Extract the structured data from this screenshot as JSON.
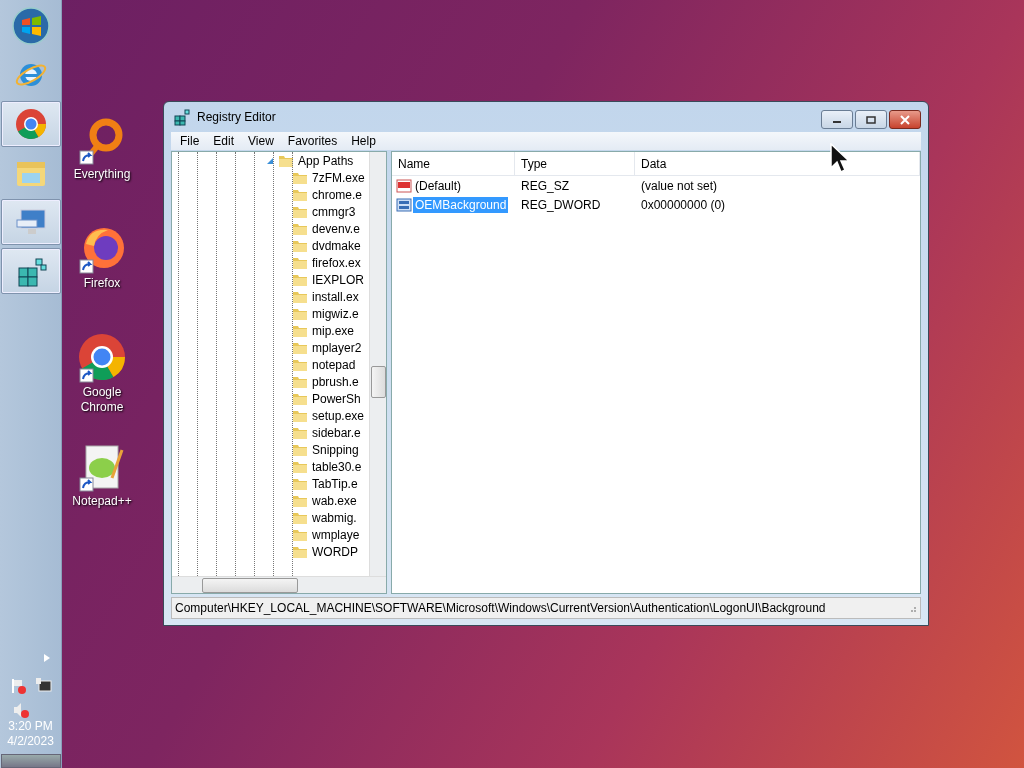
{
  "taskbar": {
    "items": [
      {
        "kind": "start",
        "running": false
      },
      {
        "kind": "ie",
        "running": false
      },
      {
        "kind": "chrome",
        "running": true
      },
      {
        "kind": "explorer",
        "running": false
      },
      {
        "kind": "remote",
        "running": true
      },
      {
        "kind": "regedit",
        "running": true
      }
    ],
    "tray": {
      "time": "3:20 PM",
      "date": "4/2/2023"
    }
  },
  "desktop_icons": [
    {
      "kind": "everything",
      "label": "Everything"
    },
    {
      "kind": "firefox",
      "label": "Firefox"
    },
    {
      "kind": "chrome",
      "label": "Google Chrome"
    },
    {
      "kind": "notepad",
      "label": "Notepad++"
    }
  ],
  "window": {
    "title": "Registry Editor",
    "menu": [
      "File",
      "Edit",
      "View",
      "Favorites",
      "Help"
    ],
    "tree": {
      "label": "App Paths",
      "expanded": true,
      "children": [
        {
          "label": "7zFM.exe"
        },
        {
          "label": "chrome.e"
        },
        {
          "label": "cmmgr3"
        },
        {
          "label": "devenv.e"
        },
        {
          "label": "dvdmake"
        },
        {
          "label": "firefox.ex"
        },
        {
          "label": "IEXPLOR"
        },
        {
          "label": "install.ex"
        },
        {
          "label": "migwiz.e"
        },
        {
          "label": "mip.exe"
        },
        {
          "label": "mplayer2"
        },
        {
          "label": "notepad"
        },
        {
          "label": "pbrush.e"
        },
        {
          "label": "PowerSh"
        },
        {
          "label": "setup.exe"
        },
        {
          "label": "sidebar.e"
        },
        {
          "label": "Snipping"
        },
        {
          "label": "table30.e"
        },
        {
          "label": "TabTip.e"
        },
        {
          "label": "wab.exe"
        },
        {
          "label": "wabmig."
        },
        {
          "label": "wmplaye"
        },
        {
          "label": "WORDP"
        }
      ]
    },
    "columns": [
      "Name",
      "Type",
      "Data"
    ],
    "values": [
      {
        "kind": "string",
        "name": "(Default)",
        "type": "REG_SZ",
        "data": "(value not set)",
        "selected": false
      },
      {
        "kind": "binary",
        "name": "OEMBackground",
        "type": "REG_DWORD",
        "data": "0x00000000 (0)",
        "selected": true
      }
    ],
    "status_bar": "Computer\\HKEY_LOCAL_MACHINE\\SOFTWARE\\Microsoft\\Windows\\CurrentVersion\\Authentication\\LogonUI\\Background"
  }
}
